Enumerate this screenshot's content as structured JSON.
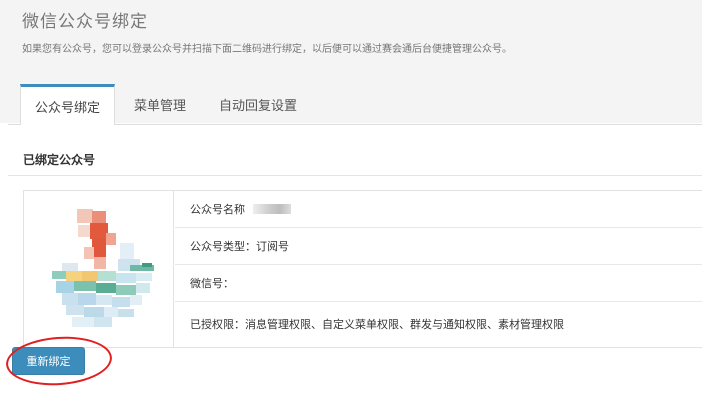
{
  "header": {
    "title": "微信公众号绑定",
    "description": "如果您有公众号，您可以登录公众号并扫描下面二维码进行绑定，以后便可以通过赛会通后台便捷管理公众号。"
  },
  "tabs": [
    {
      "label": "公众号绑定",
      "active": true
    },
    {
      "label": "菜单管理",
      "active": false
    },
    {
      "label": "自动回复设置",
      "active": false
    }
  ],
  "section": {
    "title": "已绑定公众号"
  },
  "account": {
    "name_label": "公众号名称",
    "type_text": "公众号类型：订阅号",
    "wechat_id_text": "微信号：",
    "permissions_text": "已授权限：消息管理权限、自定义菜单权限、群发与通知权限、素材管理权限"
  },
  "actions": {
    "rebind_label": "重新绑定"
  },
  "colors": {
    "accent": "#3c8dbc",
    "highlight": "#e02020"
  },
  "icons": {
    "qr": "blurred-qr-code-image"
  }
}
